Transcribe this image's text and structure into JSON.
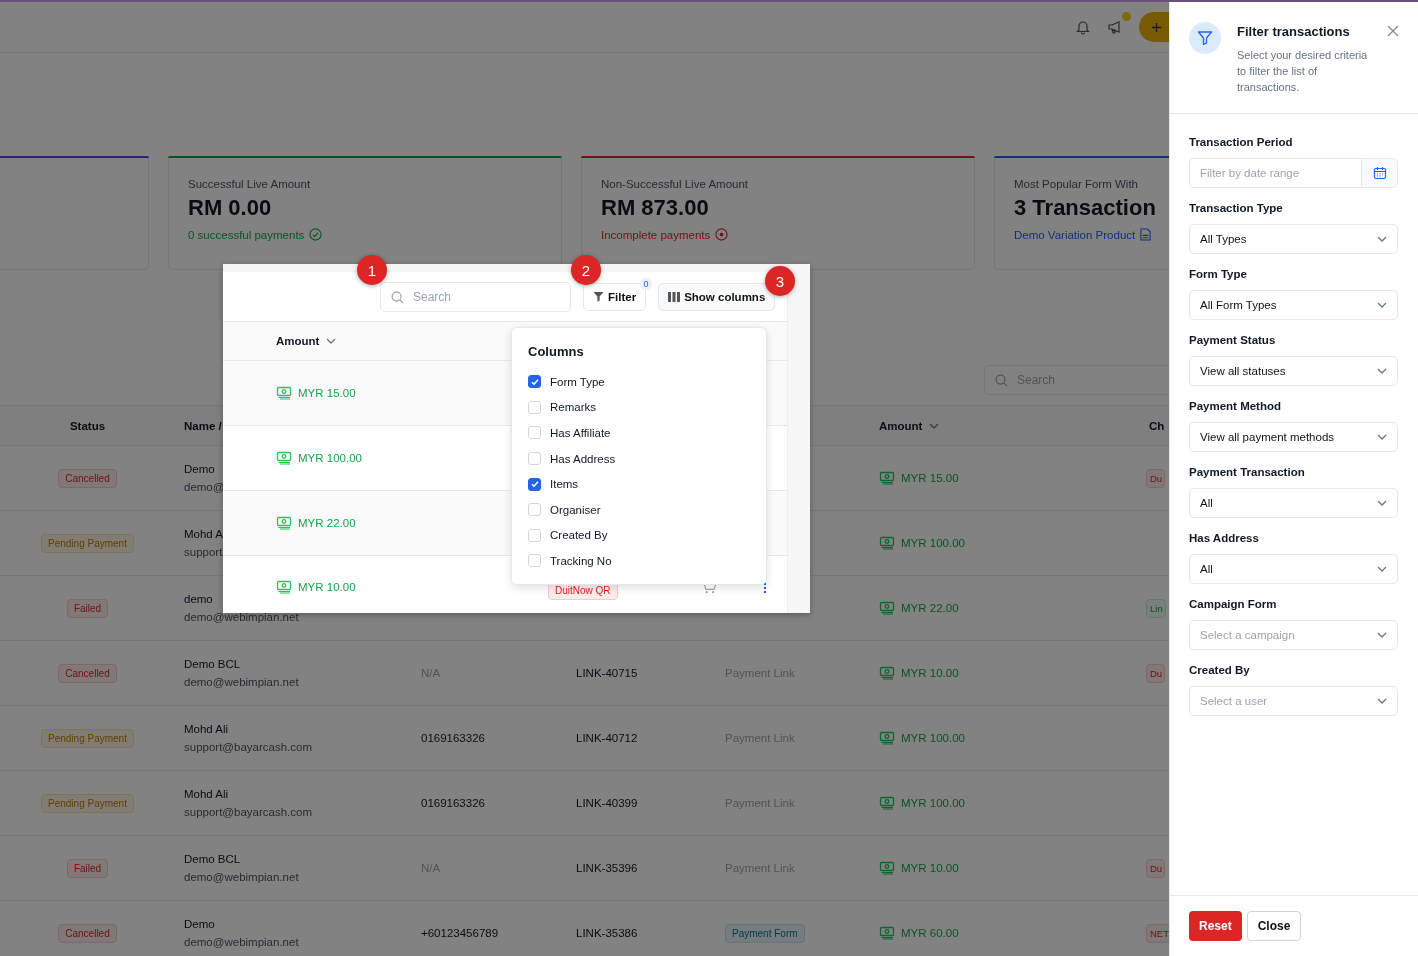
{
  "stat_cards": [
    {
      "color": "#282475"
    },
    {
      "kind": "success",
      "color": "#0b5326",
      "label": "Successful Live Amount",
      "value": "RM 0.00",
      "note": "0 successful payments"
    },
    {
      "kind": "failure",
      "color": "#701313",
      "label": "Non-Successful Live Amount",
      "value": "RM 873.00",
      "note": "Incomplete payments"
    },
    {
      "kind": "form",
      "color": "#133278",
      "label": "Most Popular Form With",
      "value": "3 Transaction",
      "note": "Demo Variation Product"
    }
  ],
  "table": {
    "search_placeholder": "Search",
    "columns": [
      "Status",
      "Name /",
      "",
      "",
      "",
      "Amount",
      "Ch"
    ],
    "rows": [
      {
        "status": {
          "label": "Cancelled",
          "kind": "danger"
        },
        "name": "Demo",
        "email": "demo@",
        "amount": "MYR 15.00",
        "channel": {
          "label": "Du",
          "kind": "danger"
        }
      },
      {
        "status": {
          "label": "Pending Payment",
          "kind": "warning"
        },
        "name": "Mohd A",
        "email": "support",
        "amount": "MYR 100.00"
      },
      {
        "status": {
          "label": "Failed",
          "kind": "danger"
        },
        "name": "demo",
        "email": "demo@webimpian.net",
        "amount": "MYR 22.00",
        "channel": {
          "label": "Lin",
          "kind": "success"
        }
      },
      {
        "status": {
          "label": "Cancelled",
          "kind": "danger"
        },
        "name": "Demo BCL",
        "email": "demo@webimpian.net",
        "phone": {
          "text": "N/A",
          "muted": true
        },
        "ref": "LINK-40715",
        "type": {
          "label": "Payment Link",
          "kind": "text"
        },
        "amount": "MYR 10.00",
        "channel": {
          "label": "Du",
          "kind": "danger"
        }
      },
      {
        "status": {
          "label": "Pending Payment",
          "kind": "warning"
        },
        "name": "Mohd Ali",
        "email": "support@bayarcash.com",
        "phone": {
          "text": "0169163326",
          "muted": false
        },
        "ref": "LINK-40712",
        "type": {
          "label": "Payment Link",
          "kind": "text"
        },
        "amount": "MYR 100.00"
      },
      {
        "status": {
          "label": "Pending Payment",
          "kind": "warning"
        },
        "name": "Mohd Ali",
        "email": "support@bayarcash.com",
        "phone": {
          "text": "0169163326",
          "muted": false
        },
        "ref": "LINK-40399",
        "type": {
          "label": "Payment Link",
          "kind": "text"
        },
        "amount": "MYR 100.00"
      },
      {
        "status": {
          "label": "Failed",
          "kind": "danger"
        },
        "name": "Demo BCL",
        "email": "demo@webimpian.net",
        "phone": {
          "text": "N/A",
          "muted": true
        },
        "ref": "LINK-35396",
        "type": {
          "label": "Payment Link",
          "kind": "text"
        },
        "amount": "MYR 10.00",
        "channel": {
          "label": "Du",
          "kind": "danger"
        }
      },
      {
        "status": {
          "label": "Cancelled",
          "kind": "danger"
        },
        "name": "Demo",
        "email": "demo@webimpian.net",
        "phone": {
          "text": "+60123456789",
          "muted": false
        },
        "ref": "LINK-35386",
        "type": {
          "label": "Payment Form",
          "kind": "tag"
        },
        "amount": "MYR 60.00",
        "channel": {
          "label": "NET",
          "kind": "danger"
        }
      }
    ]
  },
  "inset": {
    "markers": [
      "1",
      "2",
      "3"
    ],
    "search_placeholder": "Search",
    "filter_button": "Filter",
    "filter_count": "0",
    "columns_button": "Show columns",
    "column_header": "Amount",
    "rows": [
      {
        "amount": "MYR 15.00"
      },
      {
        "amount": "MYR 100.00"
      },
      {
        "amount": "MYR 22.00"
      },
      {
        "amount": "MYR 10.00",
        "tag": "DuitNow QR"
      }
    ],
    "columns_menu": {
      "title": "Columns",
      "items": [
        {
          "label": "Form Type",
          "checked": true
        },
        {
          "label": "Remarks",
          "checked": false
        },
        {
          "label": "Has Affiliate",
          "checked": false
        },
        {
          "label": "Has Address",
          "checked": false
        },
        {
          "label": "Items",
          "checked": true
        },
        {
          "label": "Organiser",
          "checked": false
        },
        {
          "label": "Created By",
          "checked": false
        },
        {
          "label": "Tracking No",
          "checked": false
        }
      ]
    }
  },
  "drawer": {
    "title": "Filter transactions",
    "subtitle": "Select your desired criteria to filter the list of transactions.",
    "fields": [
      {
        "label": "Transaction Period",
        "kind": "date",
        "placeholder": "Filter by date range"
      },
      {
        "label": "Transaction Type",
        "kind": "select",
        "value": "All Types"
      },
      {
        "label": "Form Type",
        "kind": "select",
        "value": "All Form Types"
      },
      {
        "label": "Payment Status",
        "kind": "select",
        "value": "View all statuses"
      },
      {
        "label": "Payment Method",
        "kind": "select",
        "value": "View all payment methods"
      },
      {
        "label": "Payment Transaction",
        "kind": "select",
        "value": "All"
      },
      {
        "label": "Has Address",
        "kind": "select",
        "value": "All"
      },
      {
        "label": "Campaign Form",
        "kind": "select",
        "placeholder": "Select a campaign"
      },
      {
        "label": "Created By",
        "kind": "select",
        "placeholder": "Select a user"
      }
    ],
    "buttons": [
      {
        "label": "Reset",
        "kind": "primary"
      },
      {
        "label": "Close",
        "kind": "secondary"
      }
    ]
  }
}
